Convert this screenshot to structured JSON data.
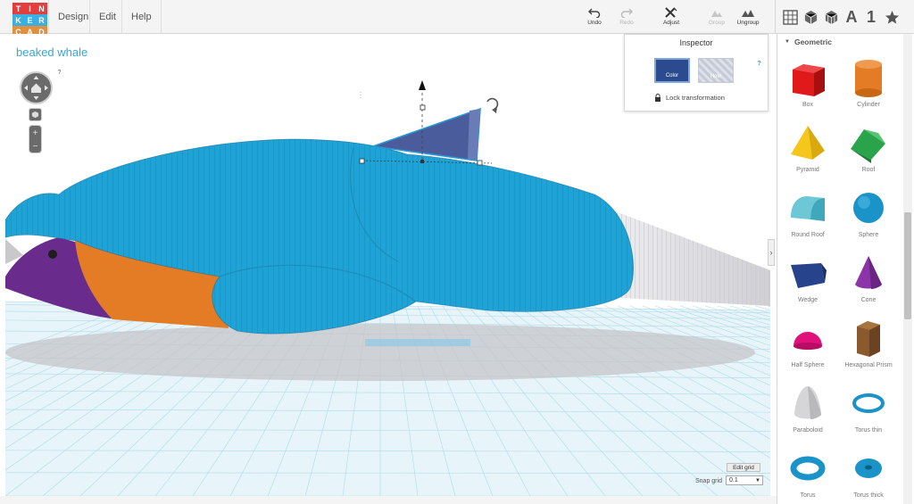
{
  "app": {
    "logo_letters": [
      "T",
      "I",
      "N",
      "K",
      "E",
      "R",
      "C",
      "A",
      "D"
    ],
    "logo_colors": [
      "#e23e3e",
      "#e23e3e",
      "#e23e3e",
      "#3ab0e2",
      "#3ab0e2",
      "#3ab0e2",
      "#e2903e",
      "#e2903e",
      "#e2903e"
    ]
  },
  "menu": [
    {
      "label": "Design"
    },
    {
      "label": "Edit"
    },
    {
      "label": "Help"
    }
  ],
  "toolbar": {
    "undo": "Undo",
    "redo": "Redo",
    "adjust": "Adjust",
    "group": "Group",
    "ungroup": "Ungroup",
    "text_tool": "A",
    "number_tool": "1"
  },
  "design": {
    "title": "beaked whale",
    "help": "?"
  },
  "inspector": {
    "title": "Inspector",
    "color_label": "Color",
    "hole_label": "Hole",
    "help": "?",
    "lock_label": "Lock transformation",
    "selected_color": "#2b4a8f"
  },
  "snap": {
    "edit_grid": "Edit grid",
    "label": "Snap grid",
    "value": "0.1"
  },
  "panel": {
    "category": "Geometric",
    "shapes": [
      {
        "label": "Box",
        "icon": "box-icon"
      },
      {
        "label": "Cylinder",
        "icon": "cylinder-icon"
      },
      {
        "label": "Pyramid",
        "icon": "pyramid-icon"
      },
      {
        "label": "Roof",
        "icon": "roof-icon"
      },
      {
        "label": "Round Roof",
        "icon": "round-roof-icon"
      },
      {
        "label": "Sphere",
        "icon": "sphere-icon"
      },
      {
        "label": "Wedge",
        "icon": "wedge-icon"
      },
      {
        "label": "Cone",
        "icon": "cone-icon"
      },
      {
        "label": "Half Sphere",
        "icon": "half-sphere-icon"
      },
      {
        "label": "Hexagonal Prism",
        "icon": "hexagonal-prism-icon"
      },
      {
        "label": "Paraboloid",
        "icon": "paraboloid-icon"
      },
      {
        "label": "Torus thin",
        "icon": "torus-thin-icon"
      },
      {
        "label": "Torus",
        "icon": "torus-icon"
      },
      {
        "label": "Torus thick",
        "icon": "torus-thick-icon"
      }
    ]
  },
  "colors": {
    "whale_body": "#1ea3d6",
    "whale_belly": "#e47b25",
    "whale_head": "#6a2c8c",
    "whale_tail": "#e6e6e9",
    "grid": "#9fd6e6",
    "accent": "#39a6d4"
  }
}
